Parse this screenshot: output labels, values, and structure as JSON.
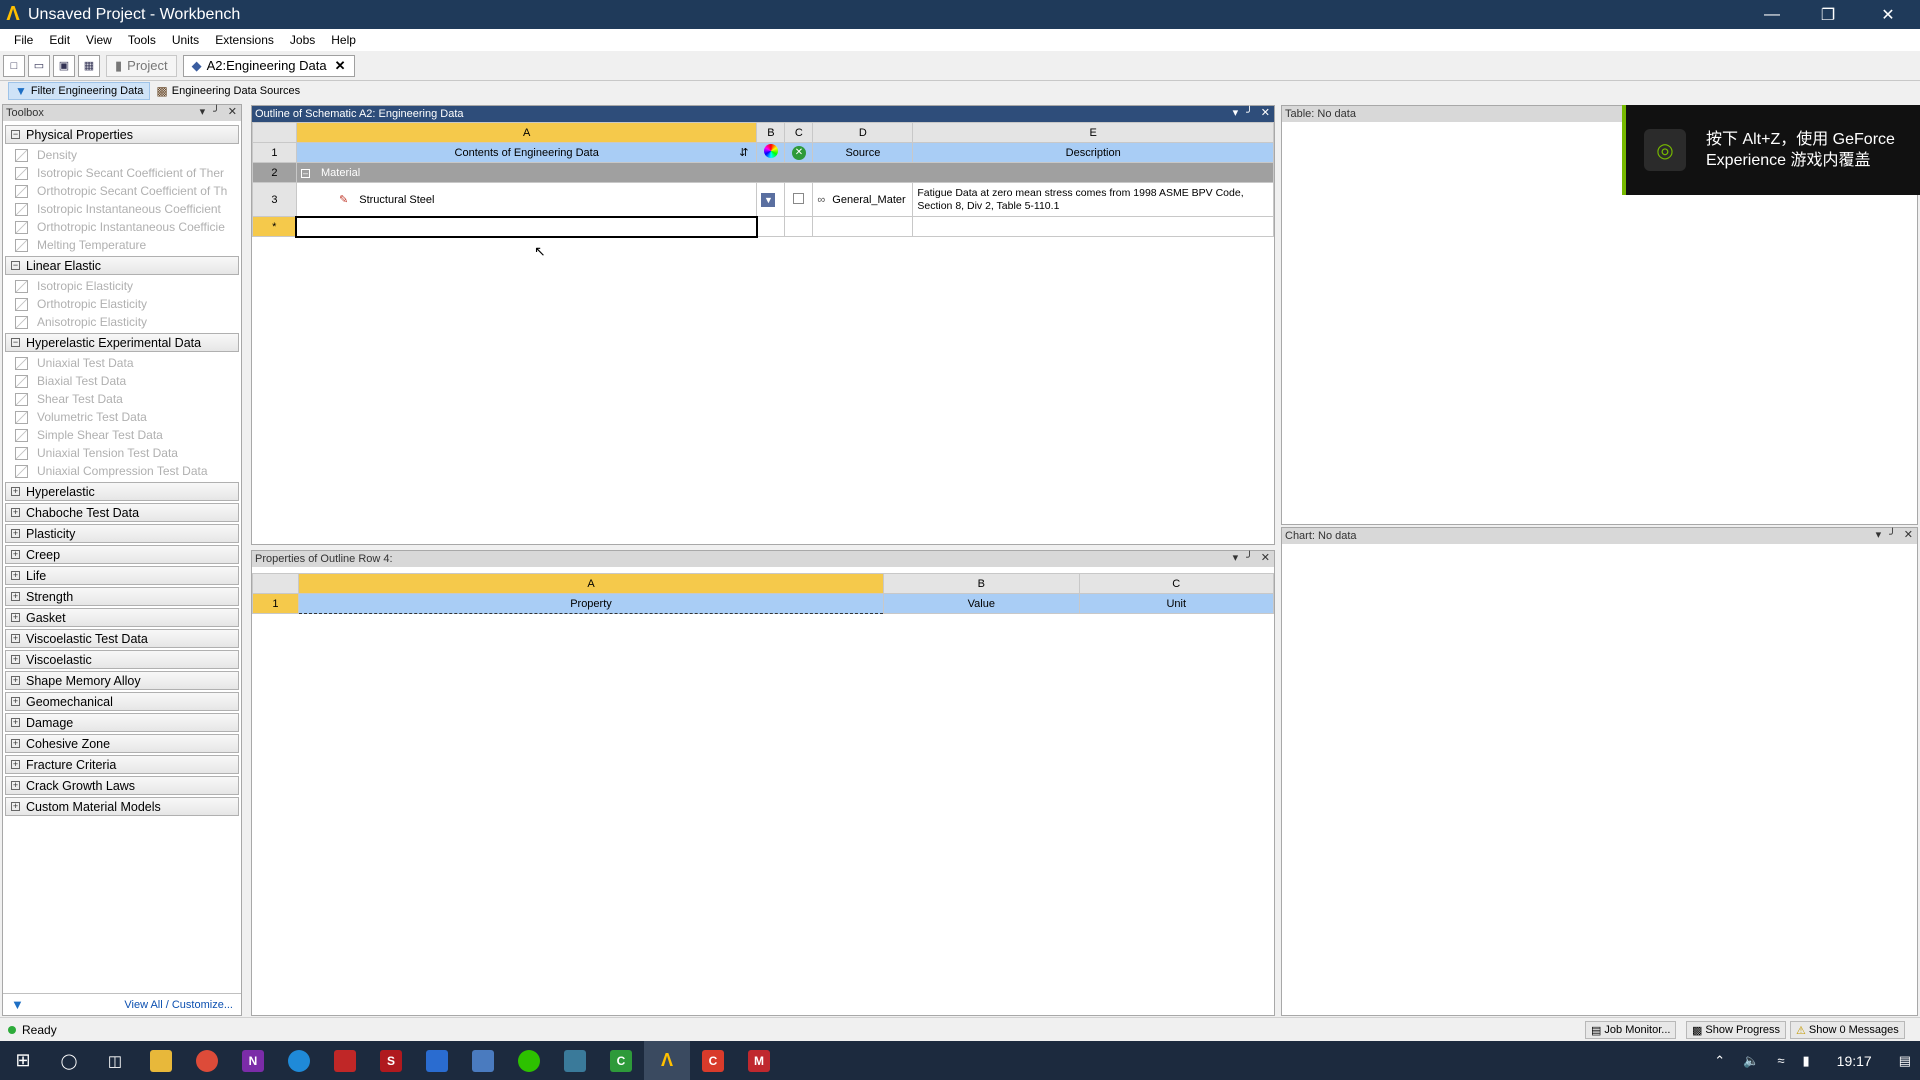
{
  "window": {
    "title": "Unsaved Project - Workbench",
    "logo": "Λ"
  },
  "menu": [
    "File",
    "Edit",
    "View",
    "Tools",
    "Units",
    "Extensions",
    "Jobs",
    "Help"
  ],
  "tabs": {
    "project": "Project",
    "engineering": "A2:Engineering Data"
  },
  "filterbar": {
    "filter": "Filter Engineering Data",
    "sources": "Engineering Data Sources"
  },
  "toolbox": {
    "title": "Toolbox",
    "footer_link": "View All / Customize...",
    "groups": [
      {
        "name": "Physical Properties",
        "expanded": true,
        "items": [
          "Density",
          "Isotropic Secant Coefficient of Ther",
          "Orthotropic Secant Coefficient of Th",
          "Isotropic Instantaneous Coefficient",
          "Orthotropic Instantaneous Coefficie",
          "Melting Temperature"
        ]
      },
      {
        "name": "Linear Elastic",
        "expanded": true,
        "items": [
          "Isotropic Elasticity",
          "Orthotropic Elasticity",
          "Anisotropic Elasticity"
        ]
      },
      {
        "name": "Hyperelastic Experimental Data",
        "expanded": true,
        "items": [
          "Uniaxial Test Data",
          "Biaxial Test Data",
          "Shear Test Data",
          "Volumetric Test Data",
          "Simple Shear Test Data",
          "Uniaxial Tension Test Data",
          "Uniaxial Compression Test Data"
        ]
      },
      {
        "name": "Hyperelastic",
        "expanded": false,
        "items": []
      },
      {
        "name": "Chaboche Test Data",
        "expanded": false,
        "items": []
      },
      {
        "name": "Plasticity",
        "expanded": false,
        "items": []
      },
      {
        "name": "Creep",
        "expanded": false,
        "items": []
      },
      {
        "name": "Life",
        "expanded": false,
        "items": []
      },
      {
        "name": "Strength",
        "expanded": false,
        "items": []
      },
      {
        "name": "Gasket",
        "expanded": false,
        "items": []
      },
      {
        "name": "Viscoelastic Test Data",
        "expanded": false,
        "items": []
      },
      {
        "name": "Viscoelastic",
        "expanded": false,
        "items": []
      },
      {
        "name": "Shape Memory Alloy",
        "expanded": false,
        "items": []
      },
      {
        "name": "Geomechanical",
        "expanded": false,
        "items": []
      },
      {
        "name": "Damage",
        "expanded": false,
        "items": []
      },
      {
        "name": "Cohesive Zone",
        "expanded": false,
        "items": []
      },
      {
        "name": "Fracture Criteria",
        "expanded": false,
        "items": []
      },
      {
        "name": "Crack Growth Laws",
        "expanded": false,
        "items": []
      },
      {
        "name": "Custom Material Models",
        "expanded": false,
        "items": []
      }
    ]
  },
  "outline": {
    "title": "Outline of Schematic A2: Engineering Data",
    "cols": [
      "A",
      "B",
      "C",
      "D",
      "E"
    ],
    "row_nums": [
      "1",
      "2",
      "3",
      "*"
    ],
    "header": {
      "contents": "Contents of Engineering Data",
      "source": "Source",
      "description": "Description"
    },
    "category": "Material",
    "material": {
      "name": "Structural Steel",
      "source": "General_Mater",
      "description": "Fatigue Data at zero mean stress comes from 1998 ASME BPV Code, Section 8, Div 2, Table 5-110.1"
    }
  },
  "properties": {
    "title": "Properties of Outline Row 4:",
    "cols": [
      "A",
      "B",
      "C"
    ],
    "row_num": "1",
    "headers": [
      "Property",
      "Value",
      "Unit"
    ]
  },
  "table_panel": {
    "title": "Table: No data"
  },
  "chart_panel": {
    "title": "Chart: No data"
  },
  "overlay": {
    "line1": "按下 Alt+Z，使用 GeForce",
    "line2": "Experience 游戏内覆盖"
  },
  "status": {
    "text": "Ready",
    "job_monitor": "Job Monitor...",
    "progress": "Show Progress",
    "messages": "Show 0 Messages"
  },
  "taskbar": {
    "time": "19:17"
  },
  "colors": {
    "title_bg": "#1f3a5a",
    "header_sel": "#f5c94b",
    "header_cell": "#a9cdf5",
    "nvidia": "#76b900"
  }
}
